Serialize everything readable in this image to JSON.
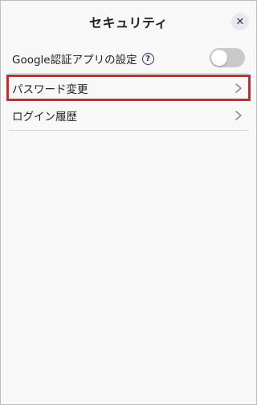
{
  "header": {
    "title": "セキュリティ",
    "close_glyph": "✕"
  },
  "items": [
    {
      "label": "Google認証アプリの設定",
      "help_glyph": "?",
      "toggle_on": false
    },
    {
      "label": "パスワード変更",
      "highlighted": true
    },
    {
      "label": "ログイン履歴"
    }
  ],
  "colors": {
    "highlight": "#d0262c",
    "accent": "#2b2f7a",
    "toggle_off": "#c9c9c9"
  },
  "icons": {
    "close": "close-icon",
    "help": "help-icon",
    "chevron": "chevron-right-icon"
  }
}
